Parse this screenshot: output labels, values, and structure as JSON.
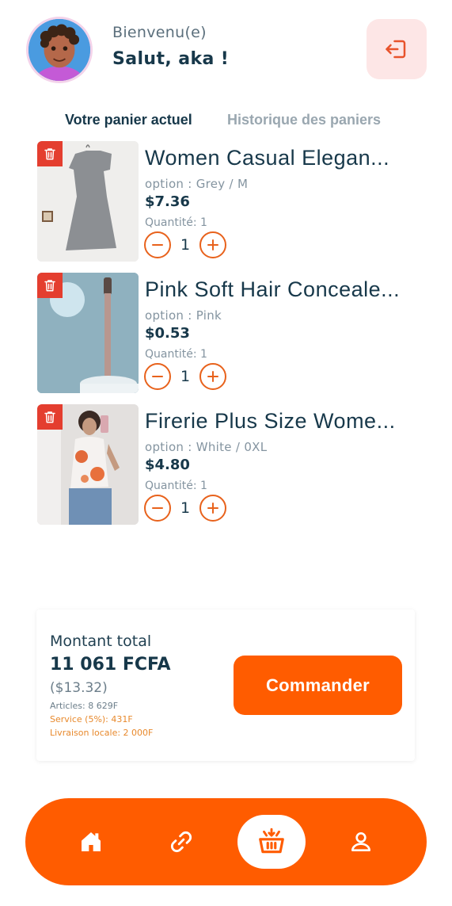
{
  "header": {
    "welcome": "Bienvenu(e)",
    "greeting": "Salut, aka !"
  },
  "tabs": [
    {
      "label": "Votre panier actuel",
      "active": true
    },
    {
      "label": "Historique des paniers",
      "active": false
    }
  ],
  "cart": {
    "items": [
      {
        "title": "Women Casual Elegan...",
        "option": "option : Grey / M",
        "price": "$7.36",
        "qty_label": "Quantité: 1",
        "qty": "1"
      },
      {
        "title": "Pink Soft Hair Conceale...",
        "option": "option : Pink",
        "price": "$0.53",
        "qty_label": "Quantité: 1",
        "qty": "1"
      },
      {
        "title": "Firerie Plus Size Wome...",
        "option": "option : White / 0XL",
        "price": "$4.80",
        "qty_label": "Quantité: 1",
        "qty": "1"
      }
    ]
  },
  "summary": {
    "label": "Montant total",
    "total": "11 061 FCFA",
    "total_usd": "($13.32)",
    "articles": "Articles: 8 629F",
    "service": "Service (5%): 431F",
    "delivery": "Livraison locale: 2 000F",
    "order_button": "Commander"
  },
  "icons": {
    "logout": "logout-icon",
    "trash": "trash-icon",
    "minus": "minus-icon",
    "plus": "plus-icon",
    "home": "home-icon",
    "link": "link-icon",
    "cart": "basket-icon",
    "profile": "user-icon"
  },
  "colors": {
    "accent": "#ff5c00",
    "primary_text": "#17384a",
    "trash_bg": "#e43e2f",
    "logout_bg": "#fde6e6"
  }
}
